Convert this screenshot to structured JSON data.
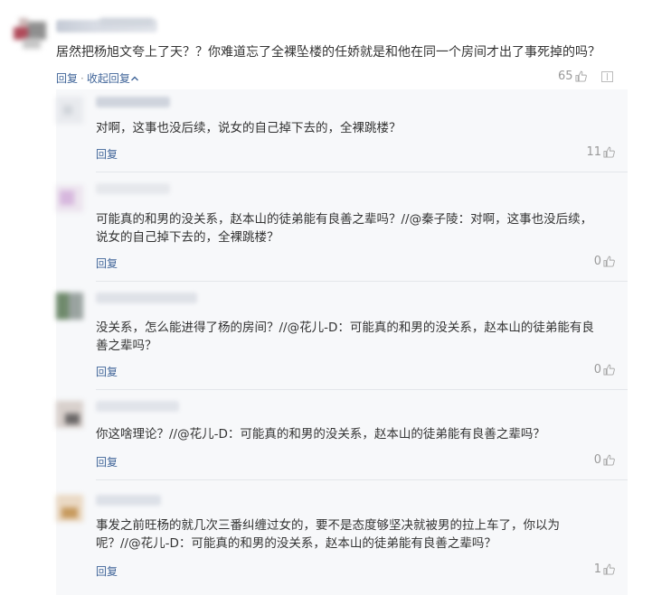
{
  "main": {
    "text": "居然把杨旭文夸上了天？？你难道忘了全裸坠楼的任娇就是和他在同一个房间才出了事死掉的吗？",
    "reply_label": "回复",
    "separator": "·",
    "collapse_label": "收起回复",
    "likes": "65"
  },
  "replies": [
    {
      "lines": [
        "对啊，这事也没后续，说女的自己掉下去的，全裸跳楼？"
      ],
      "reply_label": "回复",
      "likes": "11"
    },
    {
      "lines": [
        "可能真的和男的没关系，赵本山的徒弟能有良善之辈吗？//@秦子陵：对啊，这事也没后续，",
        "说女的自己掉下去的，全裸跳楼？"
      ],
      "reply_label": "回复",
      "likes": "0"
    },
    {
      "lines": [
        "没关系，怎么能进得了杨的房间？//@花儿-D：可能真的和男的没关系，赵本山的徒弟能有良",
        "善之辈吗？"
      ],
      "reply_label": "回复",
      "likes": "0"
    },
    {
      "lines": [
        "你这啥理论？//@花儿-D：可能真的和男的没关系，赵本山的徒弟能有良善之辈吗？"
      ],
      "reply_label": "回复",
      "likes": "0"
    },
    {
      "lines": [
        "事发之前旺杨的就几次三番纠缠过女的，要不是态度够坚决就被男的拉上车了，你以为",
        "呢？//@花儿-D：可能真的和男的没关系，赵本山的徒弟能有良善之辈吗？"
      ],
      "reply_label": "回复",
      "likes": "1"
    }
  ],
  "colors": {
    "link": "#406599",
    "text": "#333333",
    "muted": "#999999",
    "reply_bg": "#f7f8fa"
  },
  "icons": [
    "thumb-up-icon",
    "report-icon",
    "chevron-up-icon"
  ]
}
